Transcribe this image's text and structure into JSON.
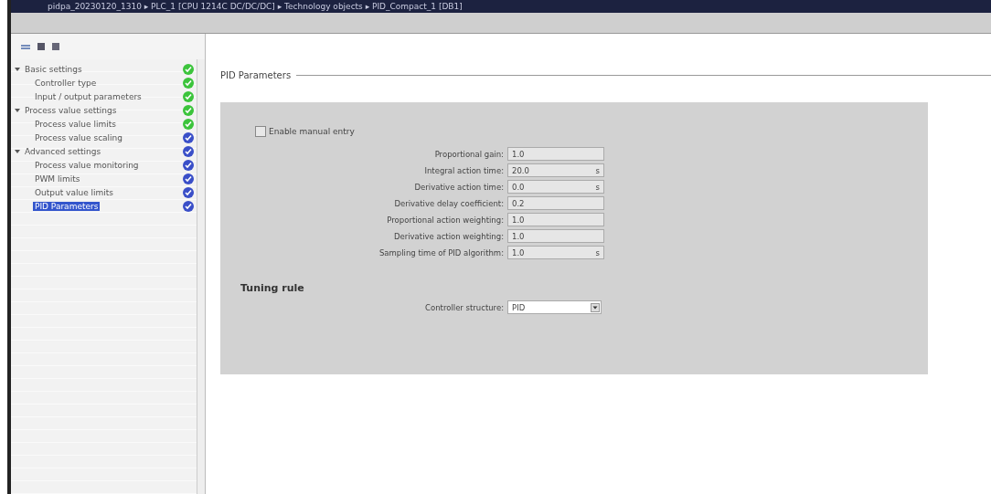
{
  "window": {
    "title": "pidpa_20230120_1310 ▸ PLC_1 [CPU 1214C DC/DC/DC] ▸ Technology objects ▸ PID_Compact_1 [DB1]"
  },
  "sidebar": {
    "items": [
      {
        "label": "Basic settings",
        "expanded": true,
        "color": "#3cc43c",
        "selected": false,
        "children": [
          {
            "label": "Controller type",
            "color": "#3cc43c",
            "selected": false
          },
          {
            "label": "Input / output parameters",
            "color": "#3cc43c",
            "selected": false
          }
        ]
      },
      {
        "label": "Process value settings",
        "expanded": true,
        "color": "#3cc43c",
        "selected": false,
        "children": [
          {
            "label": "Process value limits",
            "color": "#3cc43c",
            "selected": false
          },
          {
            "label": "Process value scaling",
            "color": "#3a4fc8",
            "selected": false
          }
        ]
      },
      {
        "label": "Advanced settings",
        "expanded": true,
        "color": "#3a4fc8",
        "selected": false,
        "children": [
          {
            "label": "Process value monitoring",
            "color": "#3a4fc8",
            "selected": false
          },
          {
            "label": "PWM limits",
            "color": "#3a4fc8",
            "selected": false
          },
          {
            "label": "Output value limits",
            "color": "#3a4fc8",
            "selected": false
          },
          {
            "label": "PID Parameters",
            "color": "#3a4fc8",
            "selected": true
          }
        ]
      }
    ]
  },
  "section": {
    "title": "PID Parameters",
    "manual_entry": {
      "label": "Enable manual entry",
      "checked": false
    },
    "fields": [
      {
        "label": "Proportional gain:",
        "value": "1.0"
      },
      {
        "label": "Integral action time:",
        "value": "20.0",
        "unit": "s"
      },
      {
        "label": "Derivative action time:",
        "value": "0.0",
        "unit": "s"
      },
      {
        "label": "Derivative delay coefficient:",
        "value": "0.2"
      },
      {
        "label": "Proportional action weighting:",
        "value": "1.0"
      },
      {
        "label": "Derivative action weighting:",
        "value": "1.0"
      },
      {
        "label": "Sampling time of PID algorithm:",
        "value": "1.0",
        "unit": "s"
      }
    ],
    "tuning_rule": {
      "title": "Tuning rule",
      "label": "Controller structure:",
      "value": "PID"
    }
  }
}
